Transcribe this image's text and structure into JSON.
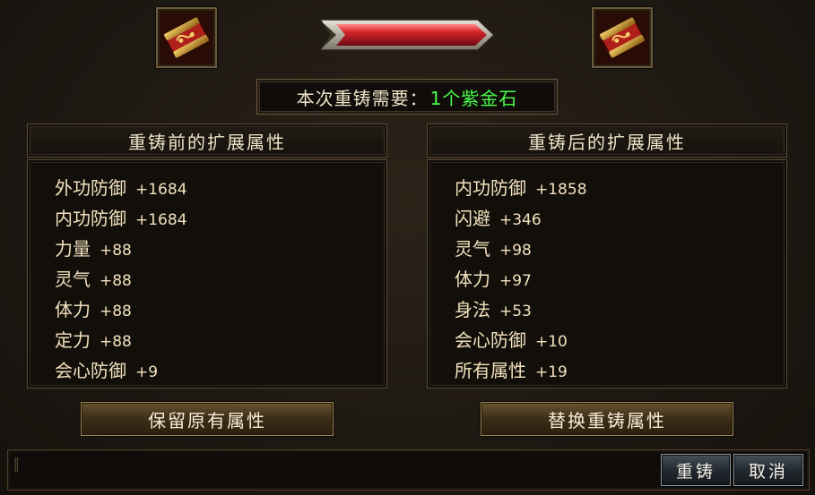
{
  "slots": {
    "before_item": "red-gold-cloth-bundle-icon",
    "after_item": "red-gold-cloth-bundle-icon"
  },
  "progress": {
    "fraction": 1.0,
    "color": "#c8202a"
  },
  "cost": {
    "label": "本次重铸需要：",
    "qty": "1个",
    "item": "紫金石",
    "item_color": "#4cff4c"
  },
  "before": {
    "title": "重铸前的扩展属性",
    "attrs": [
      {
        "name": "外功防御",
        "value": "+1684"
      },
      {
        "name": "内功防御",
        "value": "+1684"
      },
      {
        "name": "力量",
        "value": "+88"
      },
      {
        "name": "灵气",
        "value": "+88"
      },
      {
        "name": "体力",
        "value": "+88"
      },
      {
        "name": "定力",
        "value": "+88"
      },
      {
        "name": "会心防御",
        "value": "+9"
      }
    ],
    "button": "保留原有属性"
  },
  "after": {
    "title": "重铸后的扩展属性",
    "attrs": [
      {
        "name": "内功防御",
        "value": "+1858"
      },
      {
        "name": "闪避",
        "value": "+346"
      },
      {
        "name": "灵气",
        "value": "+98"
      },
      {
        "name": "体力",
        "value": "+97"
      },
      {
        "name": "身法",
        "value": "+53"
      },
      {
        "name": "会心防御",
        "value": "+10"
      },
      {
        "name": "所有属性",
        "value": "+19"
      }
    ],
    "button": "替换重铸属性"
  },
  "footer": {
    "recast_label": "重铸",
    "cancel_label": "取消"
  }
}
